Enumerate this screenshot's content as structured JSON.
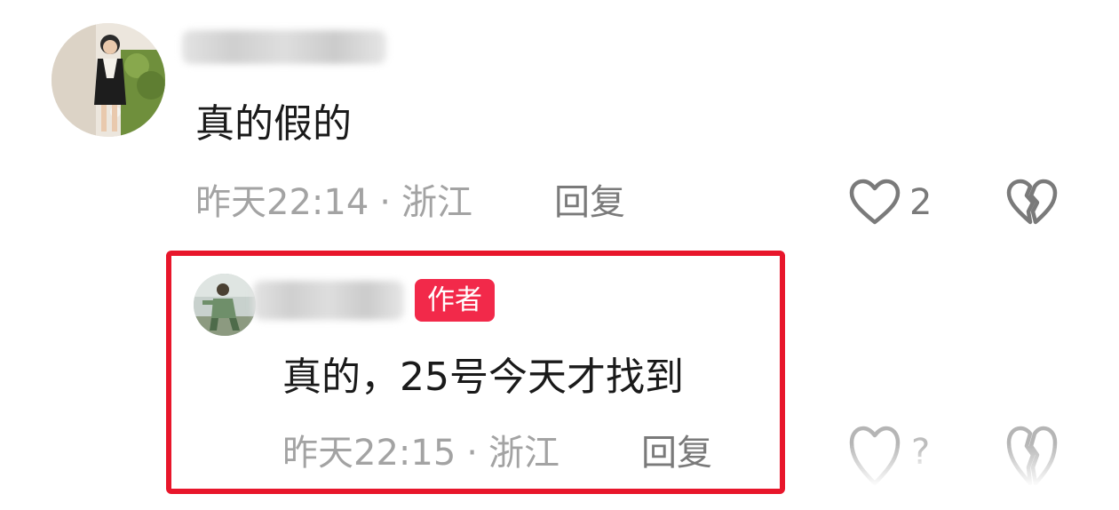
{
  "comments": [
    {
      "text": "真的假的",
      "time": "昨天22:14",
      "separator": "·",
      "location": "浙江",
      "reply_label": "回复",
      "like_count": "2",
      "icons": {
        "like": "heart-outline-icon",
        "dislike": "broken-heart-icon"
      }
    },
    {
      "badge": "作者",
      "text": "真的，25号今天才找到",
      "time": "昨天22:15",
      "separator": "·",
      "location": "浙江",
      "reply_label": "回复",
      "like_count": "?",
      "icons": {
        "like": "heart-outline-icon",
        "dislike": "broken-heart-icon"
      }
    }
  ],
  "colors": {
    "highlight_border": "#e8162b",
    "badge_bg": "#f2294a",
    "meta_text": "#a3a3a3",
    "body_text": "#1a1a1a"
  }
}
